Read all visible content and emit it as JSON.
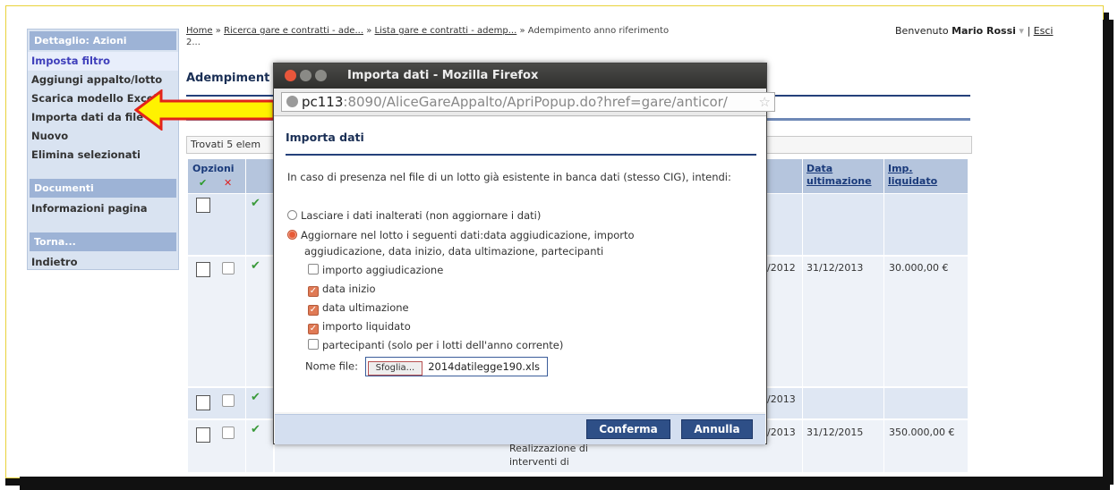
{
  "left_menu": {
    "actions_header": "Dettaglio: Azioni",
    "actions": [
      "Imposta filtro",
      "Aggiungi appalto/lotto",
      "Scarica modello Excel",
      "Importa dati da file",
      "Nuovo",
      "Elimina selezionati"
    ],
    "documents_header": "Documenti",
    "documents": [
      "Informazioni pagina"
    ],
    "back_header": "Torna...",
    "back": [
      "Indietro"
    ]
  },
  "breadcrumb": {
    "home": "Home",
    "sep": "»",
    "item1": "Ricerca gare e contratti - ade...",
    "item2": "Lista gare e contratti - ademp...",
    "current": "Adempimento anno riferimento",
    "current_cont": "2..."
  },
  "user": {
    "welcome": "Benvenuto",
    "name": "Mario Rossi",
    "separator": "|",
    "logout": "Esci"
  },
  "page": {
    "title": "Adempiment",
    "found": "Trovati 5 elem"
  },
  "table": {
    "options_header": "Opzioni",
    "col_data_ultimazione": [
      "Data",
      "ultimazione"
    ],
    "col_imp_liquidato": [
      "Imp.",
      "liquidato"
    ],
    "rows": [
      {
        "data_inizio": "",
        "data_ultimazione": "",
        "imp_liquidato": ""
      },
      {
        "data_inizio": "/2012",
        "data_ultimazione": "31/12/2013",
        "imp_liquidato": "30.000,00 €"
      },
      {
        "data_inizio": "/2013",
        "data_ultimazione": "",
        "imp_liquidato": ""
      },
      {
        "data_inizio": "/2013",
        "data_ultimazione": "31/12/2015",
        "imp_liquidato": "350.000,00 €"
      }
    ],
    "desc_line1": "Realizzazione di",
    "desc_line2": "interventi di"
  },
  "popup": {
    "window_title": "Importa dati - Mozilla Firefox",
    "url_host": "pc113",
    "url_rest": ":8090/AliceGareAppalto/ApriPopup.do?href=gare/anticor/",
    "dialog_title": "Importa dati",
    "question": "In caso di presenza nel file di un lotto già esistente in banca dati (stesso CIG), intendi:",
    "radio1": "Lasciare i dati inalterati (non aggiornare i dati)",
    "radio2_line1": "Aggiornare nel lotto i seguenti dati:data aggiudicazione, importo",
    "radio2_line2": "aggiudicazione, data inizio, data ultimazione, partecipanti",
    "checkboxes": [
      {
        "label": "importo aggiudicazione",
        "checked": false
      },
      {
        "label": "data inizio",
        "checked": true
      },
      {
        "label": "data ultimazione",
        "checked": true
      },
      {
        "label": "importo liquidato",
        "checked": true
      },
      {
        "label": "partecipanti (solo per i lotti dell'anno corrente)",
        "checked": false
      }
    ],
    "file_label": "Nome file:",
    "browse": "Sfoglia...",
    "file_name": "2014datilegge190.xls",
    "confirm": "Conferma",
    "cancel": "Annulla"
  },
  "colors": {
    "accent": "#2e4f87",
    "menu_bg": "#d9e3f1",
    "arrow_fill": "#fff200",
    "arrow_stroke": "#e2231a"
  }
}
